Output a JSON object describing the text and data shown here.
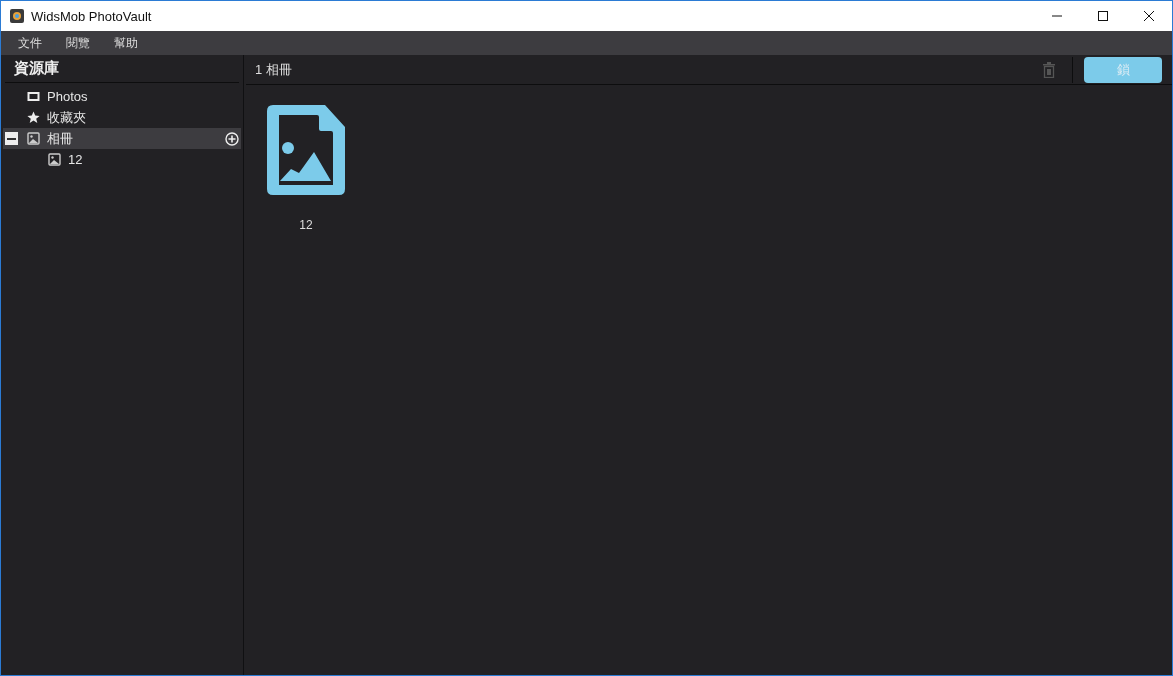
{
  "window": {
    "title": "WidsMob PhotoVault"
  },
  "menu": [
    "文件",
    "閱覽",
    "幫助"
  ],
  "sidebar": {
    "title": "資源庫",
    "items": [
      {
        "label": "Photos",
        "kind": "photos",
        "selected": false
      },
      {
        "label": "收藏夾",
        "kind": "favorites",
        "selected": false
      },
      {
        "label": "相冊",
        "kind": "album",
        "selected": true,
        "expanded": true,
        "children": [
          {
            "label": "12",
            "kind": "album",
            "selected": false
          }
        ]
      }
    ]
  },
  "content": {
    "heading": "1 相冊",
    "delete_disabled": true,
    "lock_button": "鎖",
    "albums": [
      {
        "label": "12"
      }
    ]
  }
}
